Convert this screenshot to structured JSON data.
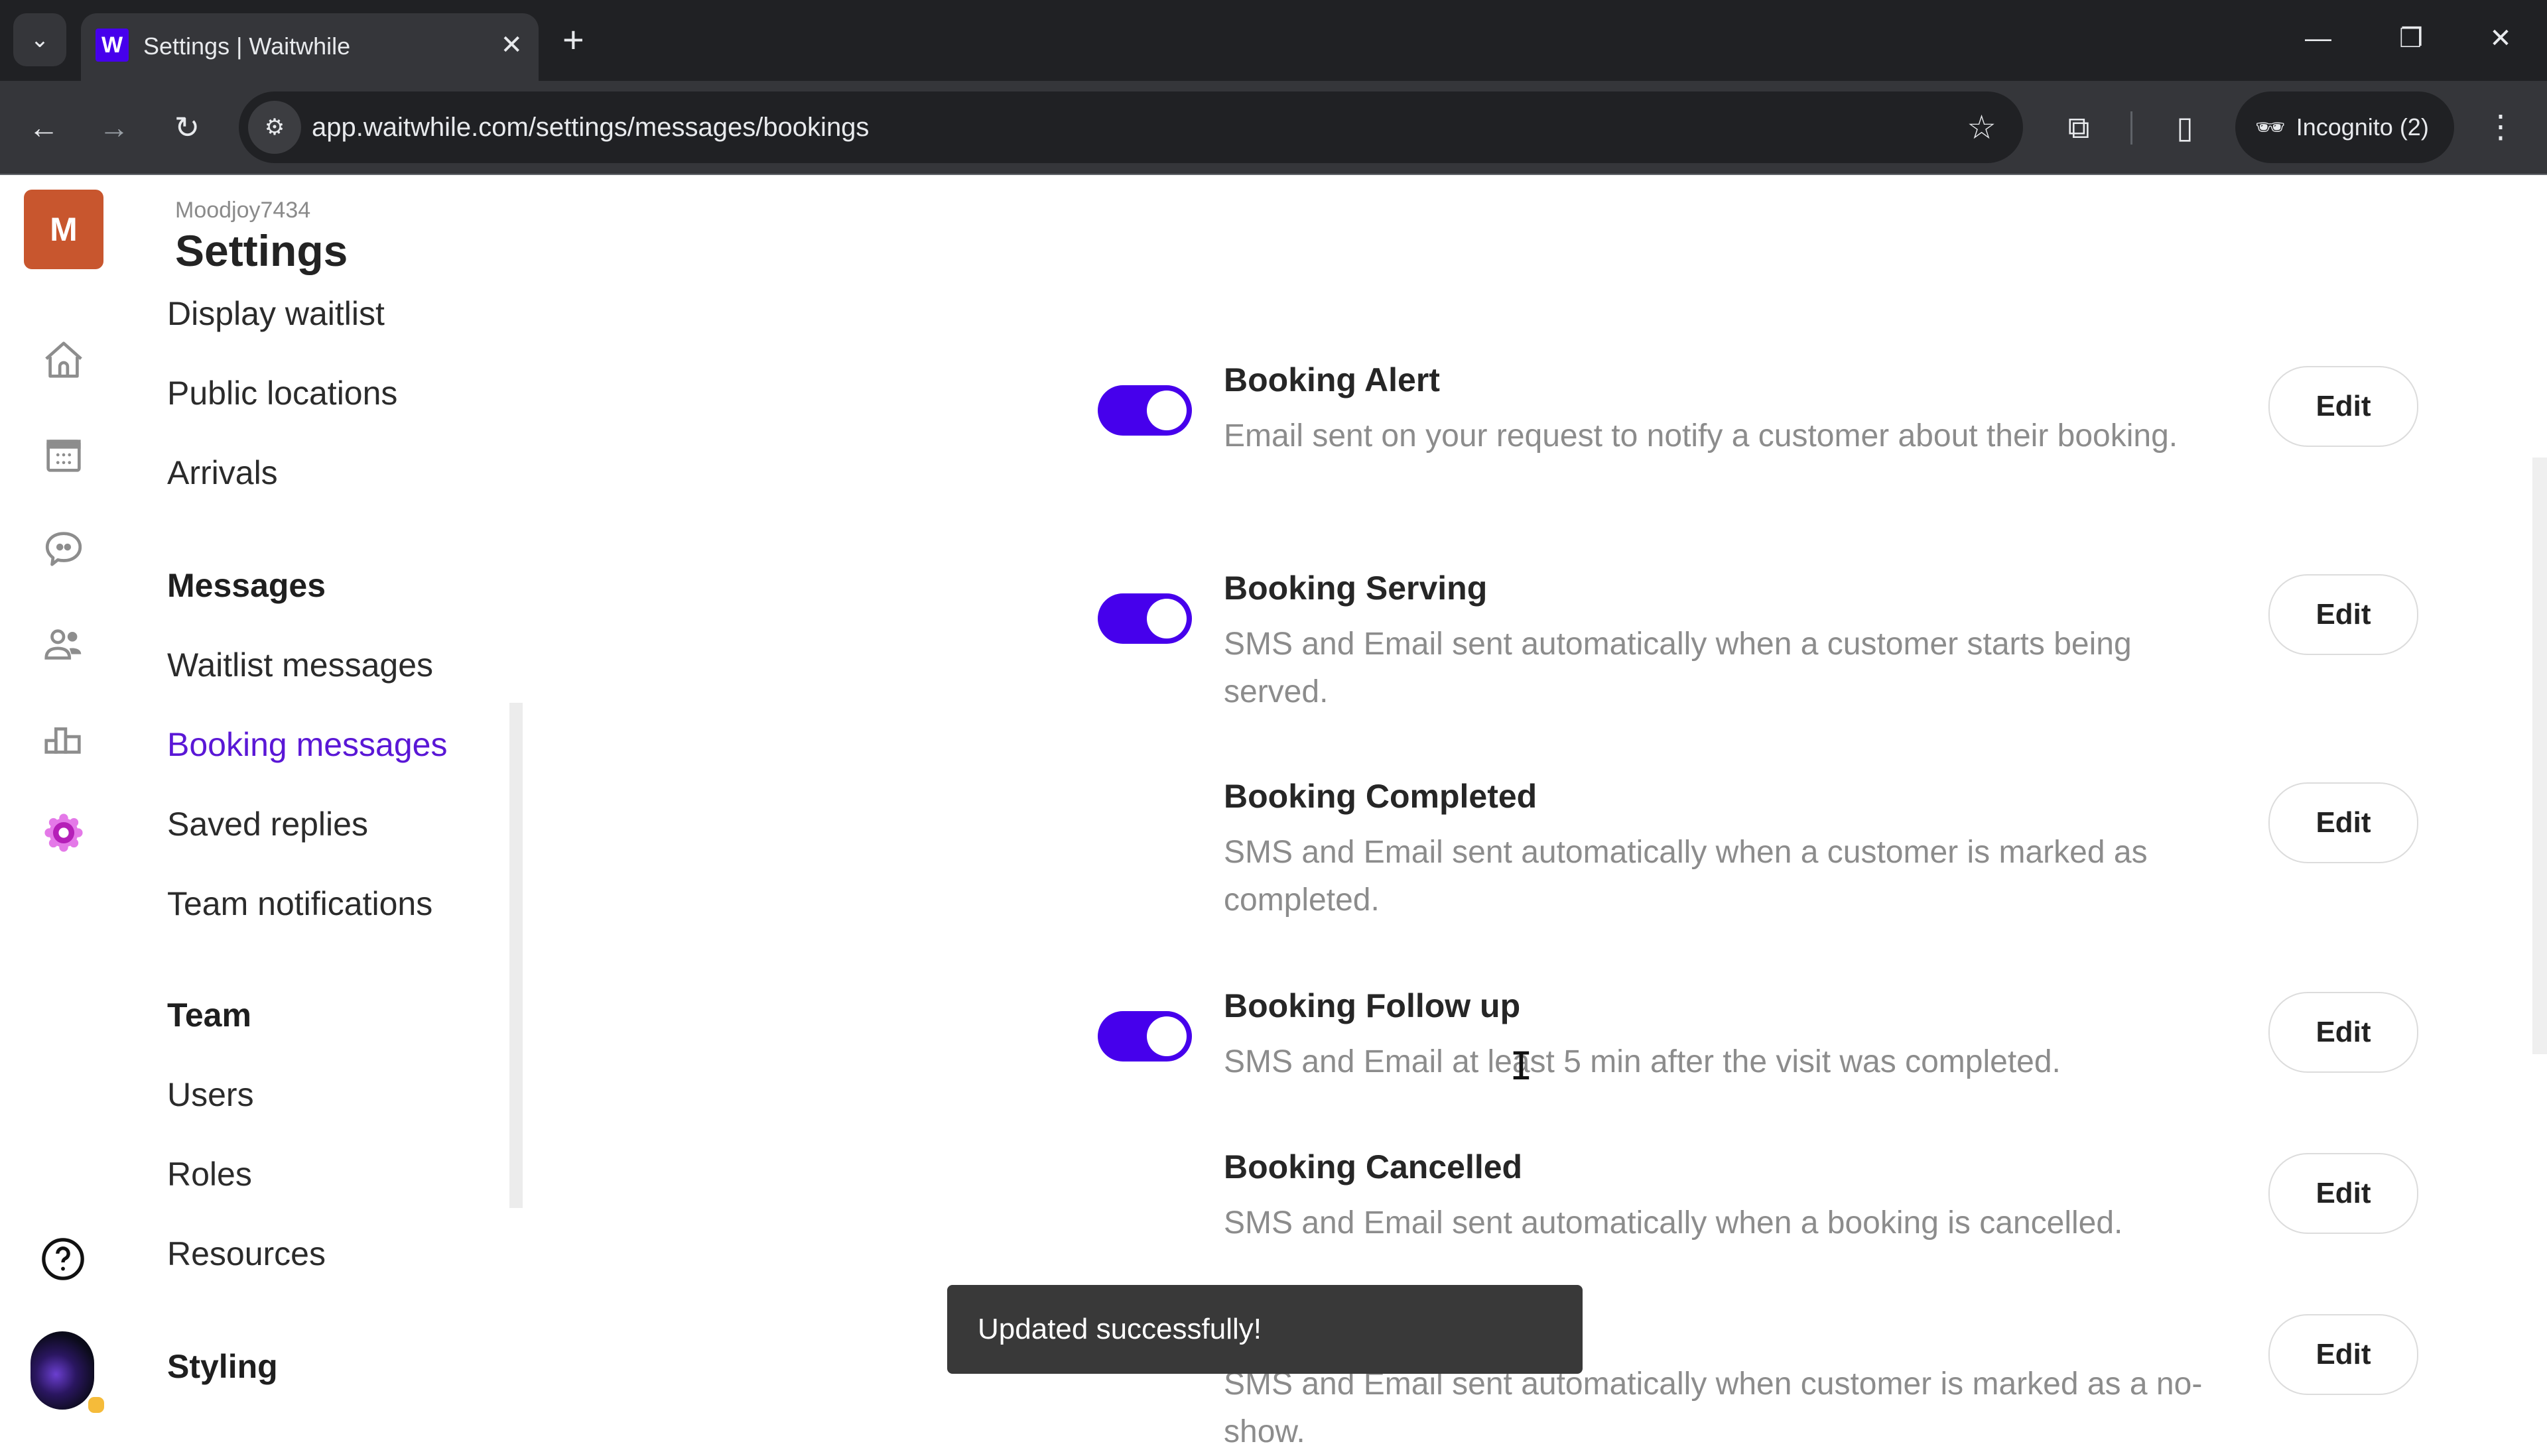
{
  "browser": {
    "tab_title": "Settings | Waitwhile",
    "favicon_letter": "W",
    "url": "app.waitwhile.com/settings/messages/bookings",
    "incognito_label": "Incognito (2)",
    "icons": {
      "tab_search": "⌄",
      "tab_close": "✕",
      "new_tab": "+",
      "minimize": "—",
      "restore": "❐",
      "close": "✕",
      "back": "←",
      "forward": "→",
      "reload": "↻",
      "site_info": "⚙",
      "bookmark": "☆",
      "extensions": "⧉",
      "side_panel": "▯",
      "incognito": "🕶",
      "menu": "⋮"
    }
  },
  "app": {
    "org_initial": "M",
    "org_name": "Moodjoy7434",
    "page_title": "Settings",
    "accent_color": "#4600ec",
    "rail_icons": [
      "home-icon",
      "calendar-icon",
      "chat-icon",
      "customers-icon",
      "analytics-icon",
      "settings-icon",
      "help-icon",
      "user-avatar"
    ]
  },
  "sidebar": {
    "items": [
      {
        "label": "Display waitlist",
        "type": "item"
      },
      {
        "label": "Public locations",
        "type": "item"
      },
      {
        "label": "Arrivals",
        "type": "item"
      },
      {
        "label": "Messages",
        "type": "section"
      },
      {
        "label": "Waitlist messages",
        "type": "item"
      },
      {
        "label": "Booking messages",
        "type": "item",
        "active": true
      },
      {
        "label": "Saved replies",
        "type": "item"
      },
      {
        "label": "Team notifications",
        "type": "item"
      },
      {
        "label": "Team",
        "type": "section"
      },
      {
        "label": "Users",
        "type": "item"
      },
      {
        "label": "Roles",
        "type": "item"
      },
      {
        "label": "Resources",
        "type": "item"
      },
      {
        "label": "Styling",
        "type": "section"
      }
    ]
  },
  "messages": [
    {
      "title": "Booking Alert",
      "description": "Email sent on your request to notify a customer about their booking.",
      "enabled": true,
      "edit_label": "Edit"
    },
    {
      "title": "Booking Serving",
      "description": "SMS and Email sent automatically when a customer starts being served.",
      "enabled": true,
      "edit_label": "Edit"
    },
    {
      "title": "Booking Completed",
      "description": "SMS and Email sent automatically when a customer is marked as completed.",
      "enabled": false,
      "edit_label": "Edit"
    },
    {
      "title": "Booking Follow up",
      "description": "SMS and Email at least 5 min after the visit was completed.",
      "enabled": true,
      "edit_label": "Edit"
    },
    {
      "title": "Booking Cancelled",
      "description": "SMS and Email sent automatically when a booking is cancelled.",
      "enabled": false,
      "edit_label": "Edit"
    },
    {
      "title": "",
      "description": "SMS and Email sent automatically when customer is marked as a no-show.",
      "enabled": false,
      "edit_label": "Edit"
    }
  ],
  "toast": {
    "message": "Updated successfully!"
  }
}
